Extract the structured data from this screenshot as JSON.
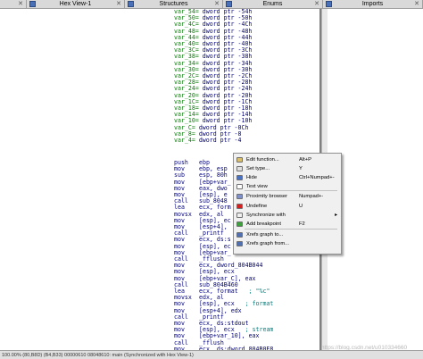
{
  "tabs": [
    {
      "label": "",
      "close": "✕"
    },
    {
      "label": "Hex View-1",
      "close": "✕"
    },
    {
      "label": "Structures",
      "close": "✕"
    },
    {
      "label": "Enums",
      "close": "✕"
    },
    {
      "label": "Imports",
      "close": "✕"
    }
  ],
  "vars": [
    {
      "name": "var_54=",
      "type": "dword ptr",
      "off": "-54h"
    },
    {
      "name": "var_50=",
      "type": "dword ptr",
      "off": "-50h"
    },
    {
      "name": "var_4C=",
      "type": "dword ptr",
      "off": "-4Ch"
    },
    {
      "name": "var_48=",
      "type": "dword ptr",
      "off": "-48h"
    },
    {
      "name": "var_44=",
      "type": "dword ptr",
      "off": "-44h"
    },
    {
      "name": "var_40=",
      "type": "dword ptr",
      "off": "-40h"
    },
    {
      "name": "var_3C=",
      "type": "dword ptr",
      "off": "-3Ch"
    },
    {
      "name": "var_38=",
      "type": "dword ptr",
      "off": "-38h"
    },
    {
      "name": "var_34=",
      "type": "dword ptr",
      "off": "-34h"
    },
    {
      "name": "var_30=",
      "type": "dword ptr",
      "off": "-30h"
    },
    {
      "name": "var_2C=",
      "type": "dword ptr",
      "off": "-2Ch"
    },
    {
      "name": "var_28=",
      "type": "dword ptr",
      "off": "-28h"
    },
    {
      "name": "var_24=",
      "type": "dword ptr",
      "off": "-24h"
    },
    {
      "name": "var_20=",
      "type": "dword ptr",
      "off": "-20h"
    },
    {
      "name": "var_1C=",
      "type": "dword ptr",
      "off": "-1Ch"
    },
    {
      "name": "var_18=",
      "type": "dword ptr",
      "off": "-18h"
    },
    {
      "name": "var_14=",
      "type": "dword ptr",
      "off": "-14h"
    },
    {
      "name": "var_10=",
      "type": "dword ptr",
      "off": "-10h"
    },
    {
      "name": "var_C=",
      "type": "dword ptr",
      "off": "-0Ch"
    },
    {
      "name": "var_8=",
      "type": "dword ptr",
      "off": "-8"
    },
    {
      "name": "var_4=",
      "type": "dword ptr",
      "off": "-4"
    }
  ],
  "code": [
    {
      "mn": "push",
      "op": "ebp",
      "cm": ""
    },
    {
      "mn": "mov",
      "op": "ebp, esp",
      "cm": ""
    },
    {
      "mn": "sub",
      "op": "esp, 80h",
      "cm": ""
    },
    {
      "mn": "mov",
      "op": "[ebp+var_",
      "cm": ""
    },
    {
      "mn": "mov",
      "op": "eax, dwo",
      "cm": ""
    },
    {
      "mn": "mov",
      "op": "[esp], e",
      "cm": ""
    },
    {
      "mn": "call",
      "op": "sub_8048",
      "cm": ""
    },
    {
      "mn": "lea",
      "op": "ecx, form",
      "cm": ""
    },
    {
      "mn": "movsx",
      "op": "edx, al",
      "cm": ""
    },
    {
      "mn": "mov",
      "op": "[esp], ec",
      "cm": ""
    },
    {
      "mn": "mov",
      "op": "[esp+4],",
      "cm": ""
    },
    {
      "mn": "call",
      "op": "_printf",
      "cm": ""
    },
    {
      "mn": "mov",
      "op": "ecx, ds:s",
      "cm": ""
    },
    {
      "mn": "mov",
      "op": "[esp], ec",
      "cm": ""
    },
    {
      "mn": "mov",
      "op": "[ebp+var_",
      "cm": ""
    },
    {
      "mn": "call",
      "op": "_fflush",
      "cm": ""
    },
    {
      "mn": "mov",
      "op": "ecx, dword_804B044",
      "cm": ""
    },
    {
      "mn": "mov",
      "op": "[esp], ecx",
      "cm": ""
    },
    {
      "mn": "mov",
      "op": "[ebp+var_C], eax",
      "cm": ""
    },
    {
      "mn": "call",
      "op": "sub_804B460",
      "cm": ""
    },
    {
      "mn": "lea",
      "op": "ecx, format",
      "cm": "; \"%c\""
    },
    {
      "mn": "movsx",
      "op": "edx, al",
      "cm": ""
    },
    {
      "mn": "mov",
      "op": "[esp], ecx",
      "cm": "; format"
    },
    {
      "mn": "mov",
      "op": "[esp+4], edx",
      "cm": ""
    },
    {
      "mn": "call",
      "op": "_printf",
      "cm": ""
    },
    {
      "mn": "mov",
      "op": "ecx, ds:stdout",
      "cm": ""
    },
    {
      "mn": "mov",
      "op": "[esp], ecx",
      "cm": "; stream"
    },
    {
      "mn": "mov",
      "op": "[ebp+var_10], eax",
      "cm": ""
    },
    {
      "mn": "call",
      "op": "_fflush",
      "cm": ""
    },
    {
      "mn": "mov",
      "op": "ecx, ds:dword_804B0E8",
      "cm": ""
    }
  ],
  "context_menu": [
    {
      "icon": "edit-function-icon",
      "color": "#d8c070",
      "label": "Edit function...",
      "shortcut": "Alt+P",
      "arrow": ""
    },
    {
      "icon": "set-type-icon",
      "color": "#e0e0e0",
      "label": "Set type...",
      "shortcut": "Y",
      "arrow": ""
    },
    {
      "icon": "hide-icon",
      "color": "#4a70c0",
      "label": "Hide",
      "shortcut": "Ctrl+Numpad+-",
      "arrow": ""
    },
    {
      "icon": "text-view-icon",
      "color": "#ffffff",
      "label": "Text view",
      "shortcut": "",
      "arrow": ""
    },
    {
      "icon": "proximity-browser-icon",
      "color": "#8090c8",
      "label": "Proximity browser",
      "shortcut": "Numpad+-",
      "arrow": ""
    },
    {
      "icon": "undefine-icon",
      "color": "#d02020",
      "label": "Undefine",
      "shortcut": "U",
      "arrow": ""
    },
    {
      "icon": "synchronize-icon",
      "color": "#f0f0f0",
      "label": "Synchronize with",
      "shortcut": "",
      "arrow": "▸"
    },
    {
      "icon": "breakpoint-icon",
      "color": "#40a040",
      "label": "Add breakpoint",
      "shortcut": "F2",
      "arrow": ""
    },
    {
      "icon": "xrefs-to-icon",
      "color": "#5070b0",
      "label": "Xrefs graph to...",
      "shortcut": "",
      "arrow": ""
    },
    {
      "icon": "xrefs-from-icon",
      "color": "#5070b0",
      "label": "Xrefs graph from...",
      "shortcut": "",
      "arrow": ""
    }
  ],
  "status_text": "100.00% (80,B8D)  (B4,B33) 00000610 08048610: main (Synchronized with Hex View-1)",
  "watermark": "https://blog.csdn.net/u010334660"
}
